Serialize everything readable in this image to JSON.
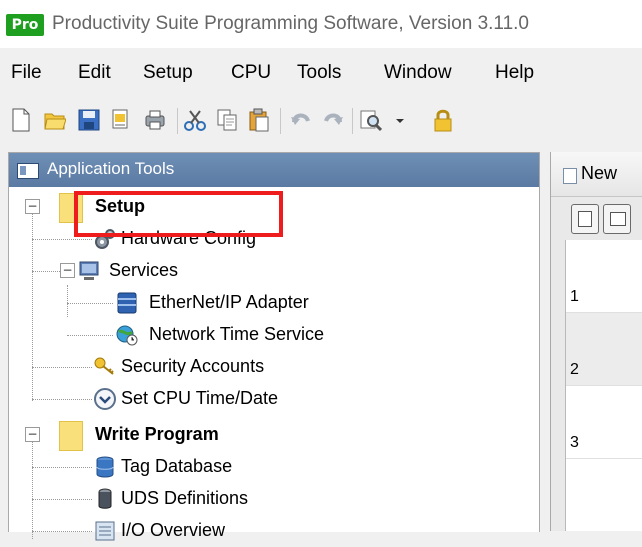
{
  "window": {
    "logo_text": "Pro",
    "title": "Productivity Suite Programming Software, Version 3.11.0"
  },
  "menu": [
    "File",
    "Edit",
    "Setup",
    "CPU",
    "Tools",
    "Window",
    "Help"
  ],
  "toolbar_icons": [
    "new-icon",
    "open-icon",
    "save-icon",
    "print-preview-icon",
    "print-icon",
    "cut-icon",
    "copy-icon",
    "paste-icon",
    "undo-icon",
    "redo-icon",
    "search-icon",
    "dropdown-arrow-icon",
    "lock-icon"
  ],
  "left_panel": {
    "title": "Application Tools",
    "tree": {
      "setup": "Setup",
      "hardware_config": "Hardware Config",
      "services": "Services",
      "ethernet_ip_adapter": "EtherNet/IP Adapter",
      "network_time_service": "Network Time Service",
      "security_accounts": "Security Accounts",
      "set_cpu_time_date": "Set CPU Time/Date",
      "write_program": "Write Program",
      "tag_database": "Tag Database",
      "uds_definitions": "UDS Definitions",
      "io_overview": "I/O Overview"
    }
  },
  "right_panel": {
    "tab_title": "New",
    "rows": [
      "1",
      "2",
      "3"
    ]
  },
  "colors": {
    "highlight": "#ee1c1c",
    "panel_header": "#6e8fb6",
    "logo": "#1f9f1f"
  }
}
